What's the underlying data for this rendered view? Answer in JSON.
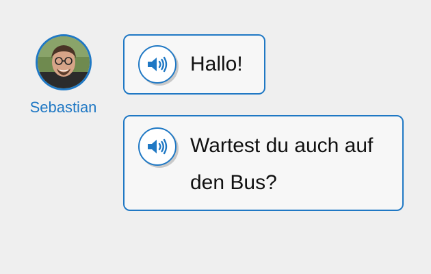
{
  "speaker": {
    "name": "Sebastian",
    "accent_color": "#1f78c4"
  },
  "messages": [
    {
      "text": "Hallo!",
      "icon": "speaker-icon"
    },
    {
      "text": "Wartest du auch auf den Bus?",
      "icon": "speaker-icon"
    }
  ]
}
